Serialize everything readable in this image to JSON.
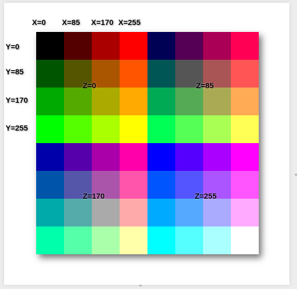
{
  "labels": {
    "x": [
      "X=0",
      "X=85",
      "X=170",
      "X=255"
    ],
    "y": [
      "Y=0",
      "Y=85",
      "Y=170",
      "Y=255"
    ],
    "z": [
      "Z=0",
      "Z=85",
      "Z=170",
      "Z=255"
    ]
  },
  "levels": [
    0,
    85,
    170,
    255
  ],
  "colors": {
    "page_background": "#ededed",
    "paper": "#ffffff"
  }
}
